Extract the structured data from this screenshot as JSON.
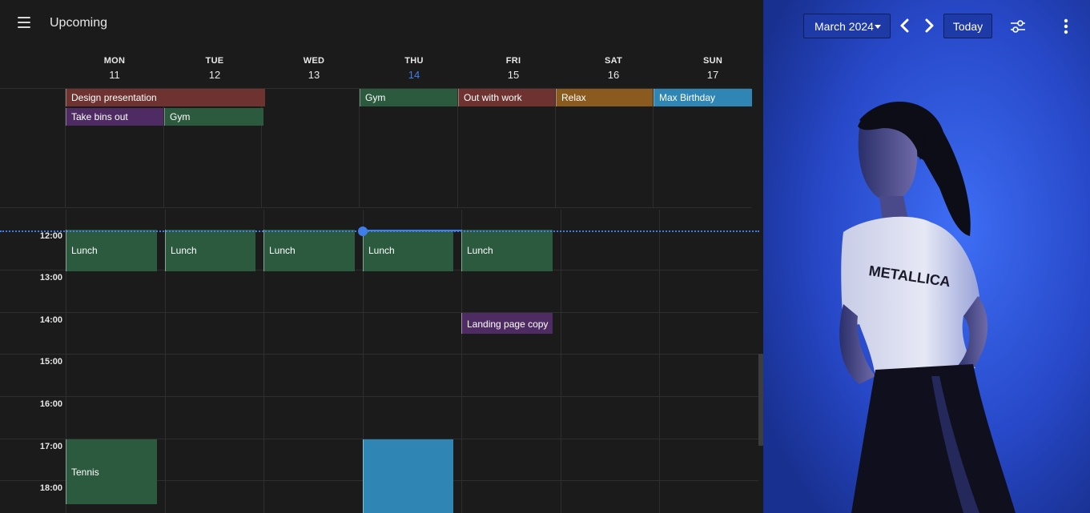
{
  "header": {
    "title": "Upcoming"
  },
  "days": [
    {
      "name": "MON",
      "num": "11"
    },
    {
      "name": "TUE",
      "num": "12"
    },
    {
      "name": "WED",
      "num": "13"
    },
    {
      "name": "THU",
      "num": "14",
      "today": true
    },
    {
      "name": "FRI",
      "num": "15"
    },
    {
      "name": "SAT",
      "num": "16"
    },
    {
      "name": "SUN",
      "num": "17"
    }
  ],
  "all_day_events": [
    {
      "label": "Design presentation",
      "color": "#6e3330"
    },
    {
      "label": "Take bins out",
      "color": "#4e2c63"
    },
    {
      "label": "Gym",
      "color": "#2b5a3e"
    },
    {
      "label": "Gym",
      "color": "#2b5a3e"
    },
    {
      "label": "Out with work",
      "color": "#6e3330"
    },
    {
      "label": "Relax",
      "color": "#8a5a1e"
    },
    {
      "label": "Max Birthday",
      "color": "#2f86b4"
    }
  ],
  "times": [
    "12:00",
    "13:00",
    "14:00",
    "15:00",
    "16:00",
    "17:00",
    "18:00"
  ],
  "timed_events": [
    {
      "label": "Lunch",
      "color": "#2b5a3e"
    },
    {
      "label": "Lunch",
      "color": "#2b5a3e"
    },
    {
      "label": "Lunch",
      "color": "#2b5a3e"
    },
    {
      "label": "Lunch",
      "color": "#2b5a3e"
    },
    {
      "label": "Lunch",
      "color": "#2b5a3e"
    },
    {
      "label": "Landing page copy",
      "color": "#4e2c63"
    },
    {
      "label": "Tennis",
      "color": "#2b5a3e"
    },
    {
      "label": "",
      "color": "#2f86b4"
    }
  ],
  "toolbar": {
    "month_label": "March 2024",
    "today_label": "Today",
    "icons": [
      "hamburger-menu-icon",
      "chevron-left-icon",
      "chevron-right-icon",
      "filter-sliders-icon",
      "more-vertical-icon"
    ]
  },
  "photo": {
    "shirt_text": "METALLICA",
    "accent_color": "#2a4fd6"
  }
}
